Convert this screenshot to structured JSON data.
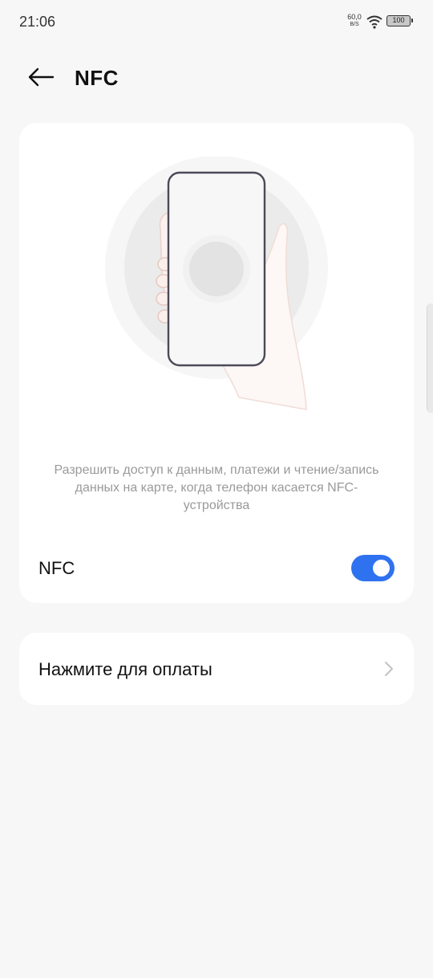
{
  "status_bar": {
    "time": "21:06",
    "net_speed_value": "60,0",
    "net_speed_unit": "B/S",
    "battery": "100",
    "wifi_icon": "wifi-icon"
  },
  "header": {
    "back_icon": "arrow-left-icon",
    "title": "NFC"
  },
  "nfc_card": {
    "illustration": "phone-in-hand-nfc-illustration",
    "description": "Разрешить доступ к данным, платежи и чтение/запись данных на карте, когда телефон касается NFC-устройства",
    "toggle_label": "NFC",
    "toggle_on": true,
    "toggle_color": "#2f72f0"
  },
  "pay_card": {
    "label": "Нажмите для оплаты",
    "chevron_icon": "chevron-right-icon"
  }
}
